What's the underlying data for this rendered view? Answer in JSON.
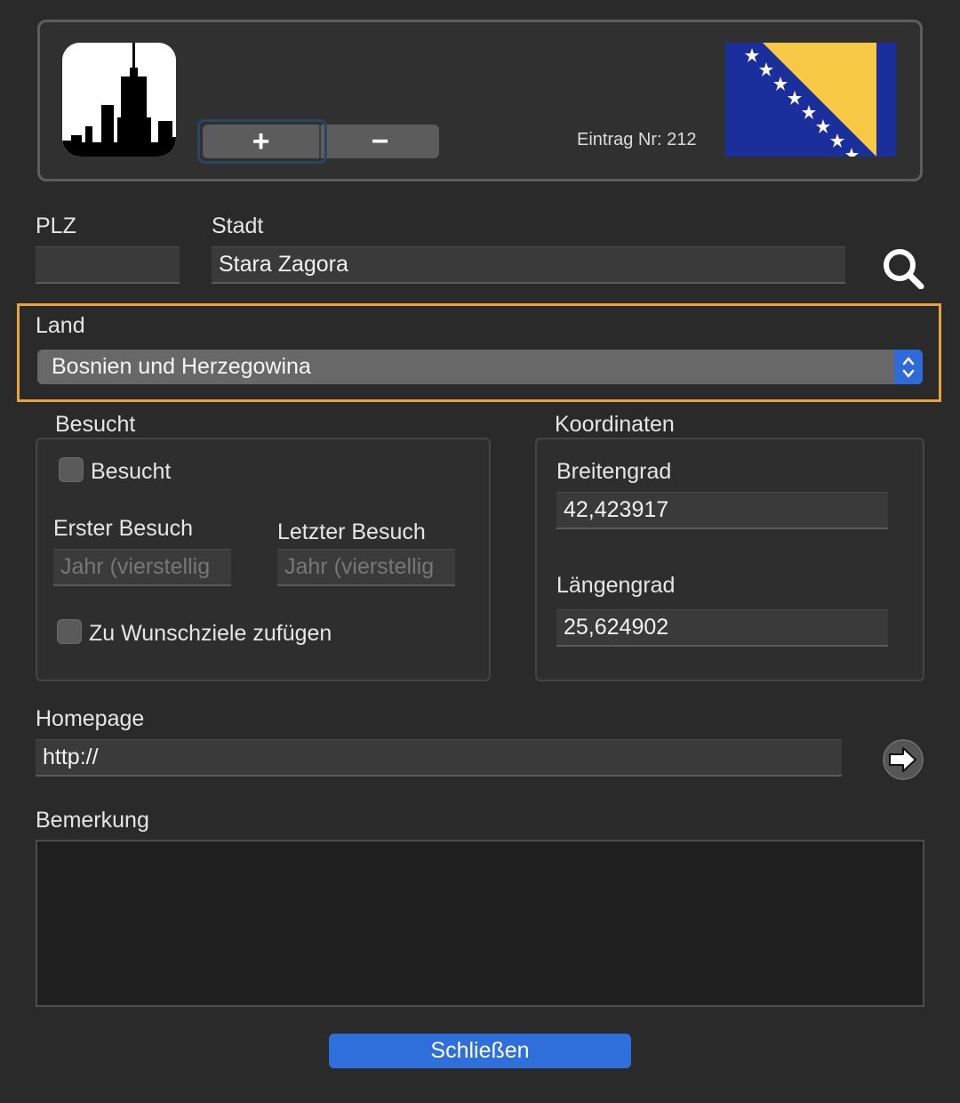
{
  "header": {
    "city_icon": "city-skyline-icon",
    "plus_label": "+",
    "minus_label": "−",
    "entry_label": "Eintrag Nr: 212",
    "flag": "bosnia-herzegovina-flag"
  },
  "fields": {
    "plz_label": "PLZ",
    "plz_value": "",
    "stadt_label": "Stadt",
    "stadt_value": "Stara Zagora",
    "search_icon": "search-icon"
  },
  "land": {
    "label": "Land",
    "selected": "Bosnien und Herzegowina"
  },
  "besucht": {
    "group_title": "Besucht",
    "checkbox_label": "Besucht",
    "erster_label": "Erster Besuch",
    "erster_placeholder": "Jahr (vierstellig",
    "letzter_label": "Letzter Besuch",
    "letzter_placeholder": "Jahr (vierstellig",
    "wunsch_label": "Zu Wunschziele zufügen"
  },
  "koordinaten": {
    "group_title": "Koordinaten",
    "breite_label": "Breitengrad",
    "breite_value": "42,423917",
    "laenge_label": "Längengrad",
    "laenge_value": "25,624902"
  },
  "homepage": {
    "label": "Homepage",
    "value": "http://",
    "go_icon": "arrow-right-icon"
  },
  "bemerkung": {
    "label": "Bemerkung",
    "value": ""
  },
  "footer": {
    "close_label": "Schließen"
  },
  "colors": {
    "background": "#2a2a2a",
    "accent": "#2f6fdc",
    "focus_outline": "#e8a33a"
  }
}
